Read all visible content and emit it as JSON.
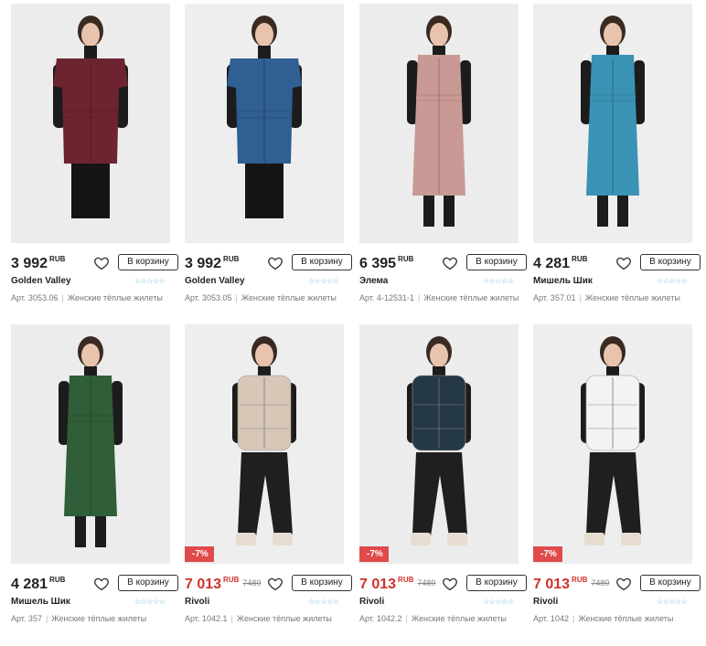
{
  "cart_label": "В корзину",
  "currency": "RUB",
  "stars": "☆☆☆☆☆",
  "category": "Женские тёплые жилеты",
  "products": [
    {
      "price": "3 992",
      "old_price": "",
      "discount": "",
      "brand": "Golden Valley",
      "article": "Арт. 3053.06",
      "garment_color": "#6e2430",
      "garment": "vest-short"
    },
    {
      "price": "3 992",
      "old_price": "",
      "discount": "",
      "brand": "Golden Valley",
      "article": "Арт. 3053.05",
      "garment_color": "#2f5f93",
      "garment": "vest-short"
    },
    {
      "price": "6 395",
      "old_price": "",
      "discount": "",
      "brand": "Элема",
      "article": "Арт. 4-12531-1",
      "garment_color": "#c99a95",
      "garment": "vest-long"
    },
    {
      "price": "4 281",
      "old_price": "",
      "discount": "",
      "brand": "Мишель Шик",
      "article": "Арт. 357.01",
      "garment_color": "#3a93b5",
      "garment": "vest-long"
    },
    {
      "price": "4 281",
      "old_price": "",
      "discount": "",
      "brand": "Мишель Шик",
      "article": "Арт. 357",
      "garment_color": "#2f5e38",
      "garment": "vest-long"
    },
    {
      "price": "7 013",
      "old_price": "7489",
      "discount": "-7%",
      "brand": "Rivoli",
      "article": "Арт. 1042.1",
      "garment_color": "#d7c7b7",
      "garment": "puffer"
    },
    {
      "price": "7 013",
      "old_price": "7489",
      "discount": "-7%",
      "brand": "Rivoli",
      "article": "Арт. 1042.2",
      "garment_color": "#243845",
      "garment": "puffer"
    },
    {
      "price": "7 013",
      "old_price": "7489",
      "discount": "-7%",
      "brand": "Rivoli",
      "article": "Арт. 1042",
      "garment_color": "#f3f3f3",
      "garment": "puffer"
    }
  ]
}
